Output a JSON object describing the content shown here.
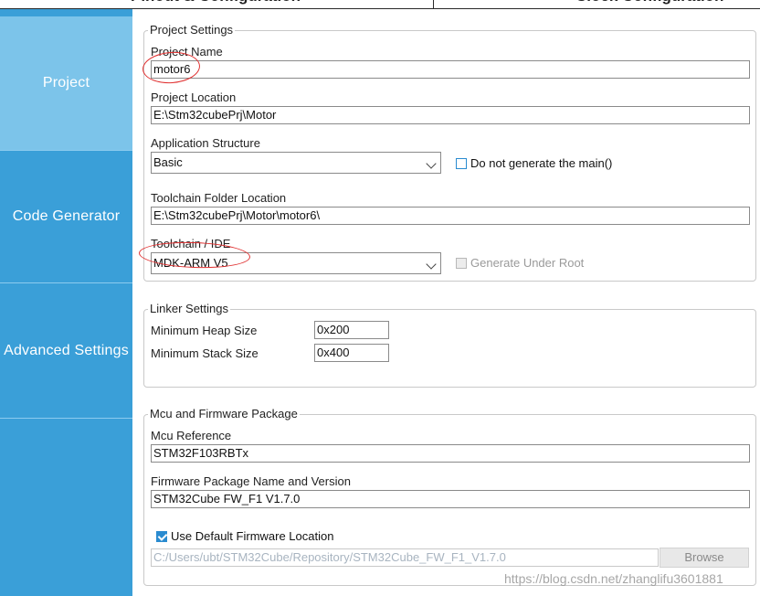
{
  "header": {
    "tab_left": "Pinout & Configuration",
    "tab_right": "Clock Configuration"
  },
  "sidebar": {
    "items": [
      {
        "label": "Project"
      },
      {
        "label": "Code Generator"
      },
      {
        "label": "Advanced Settings"
      }
    ]
  },
  "project_settings": {
    "legend": "Project Settings",
    "name_label": "Project Name",
    "name_value": "motor6",
    "location_label": "Project Location",
    "location_value": "E:\\Stm32cubePrj\\Motor",
    "structure_label": "Application Structure",
    "structure_value": "Basic",
    "no_main_label": "Do not generate the main()",
    "toolchain_folder_label": "Toolchain Folder Location",
    "toolchain_folder_value": "E:\\Stm32cubePrj\\Motor\\motor6\\",
    "toolchain_label": "Toolchain / IDE",
    "toolchain_value": "MDK-ARM V5",
    "under_root_label": "Generate Under Root"
  },
  "linker_settings": {
    "legend": "Linker Settings",
    "heap_label": "Minimum Heap Size",
    "heap_value": "0x200",
    "stack_label": "Minimum Stack Size",
    "stack_value": "0x400"
  },
  "mcu_firmware": {
    "legend": "Mcu and Firmware Package",
    "mcu_label": "Mcu Reference",
    "mcu_value": "STM32F103RBTx",
    "fw_label": "Firmware Package Name and Version",
    "fw_value": "STM32Cube FW_F1 V1.7.0",
    "default_location_label": "Use Default Firmware Location",
    "fw_path_value": "C:/Users/ubt/STM32Cube/Repository/STM32Cube_FW_F1_V1.7.0",
    "browse_label": "Browse"
  },
  "watermark": "https://blog.csdn.net/zhanglifu3601881",
  "colors": {
    "sidebar": "#3a9fd8",
    "sidebar_active": "#7cc4ea",
    "annotation": "#e03030",
    "checkbox": "#2a8bd0"
  }
}
